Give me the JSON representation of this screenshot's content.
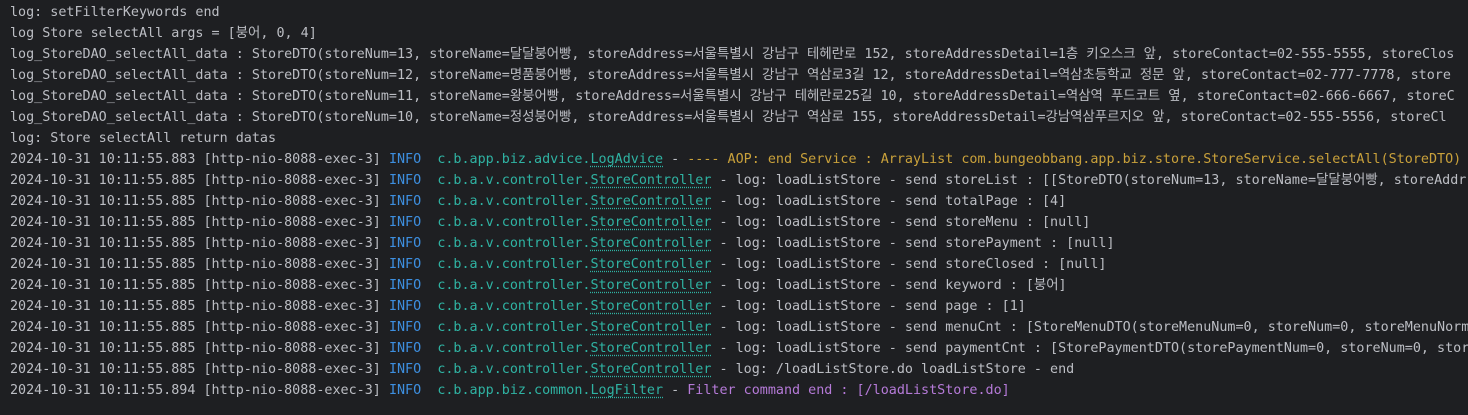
{
  "colors": {
    "background": "#1e1f22",
    "text": "#bcbec4",
    "info_level": "#3d8fe0",
    "logger": "#2fb3a3",
    "aop_message": "#c9a13b",
    "filter_message": "#b57ad8"
  },
  "plain_lines": [
    "log: setFilterKeywords end",
    "log Store selectAll args = [붕어, 0, 4]",
    "log_StoreDAO_selectAll_data : StoreDTO(storeNum=13, storeName=달달붕어빵, storeAddress=서울특별시 강남구 테헤란로 152, storeAddressDetail=1층 키오스크 앞, storeContact=02-555-5555, storeClos",
    "log_StoreDAO_selectAll_data : StoreDTO(storeNum=12, storeName=명품붕어빵, storeAddress=서울특별시 강남구 역삼로3길 12, storeAddressDetail=역삼초등학교 정문 앞, storeContact=02-777-7778, store",
    "log_StoreDAO_selectAll_data : StoreDTO(storeNum=11, storeName=왕붕어빵, storeAddress=서울특별시 강남구 테헤란로25길 10, storeAddressDetail=역삼역 푸드코트 옆, storeContact=02-666-6667, storeC",
    "log_StoreDAO_selectAll_data : StoreDTO(storeNum=10, storeName=정성붕어빵, storeAddress=서울특별시 강남구 역삼로 155, storeAddressDetail=강남역삼푸르지오 앞, storeContact=02-555-5556, storeCl",
    "log: Store selectAll return datas"
  ],
  "log_entries": [
    {
      "timestamp": "2024-10-31 10:11:55.883",
      "thread": "[http-nio-8088-exec-3]",
      "level": "INFO",
      "logger_pkg": "c.b.app.biz.advice.",
      "logger_class": "LogAdvice",
      "separator": "-",
      "message": "---- AOP: end Service : ArrayList com.bungeobbang.app.biz.store.StoreService.selectAll(StoreDTO)"
    },
    {
      "timestamp": "2024-10-31 10:11:55.885",
      "thread": "[http-nio-8088-exec-3]",
      "level": "INFO",
      "logger_pkg": "c.b.a.v.controller.",
      "logger_class": "StoreController",
      "separator": "-",
      "message": "log: loadListStore - send storeList : [[StoreDTO(storeNum=13, storeName=달달붕어빵, storeAddr"
    },
    {
      "timestamp": "2024-10-31 10:11:55.885",
      "thread": "[http-nio-8088-exec-3]",
      "level": "INFO",
      "logger_pkg": "c.b.a.v.controller.",
      "logger_class": "StoreController",
      "separator": "-",
      "message": "log: loadListStore - send totalPage : [4]"
    },
    {
      "timestamp": "2024-10-31 10:11:55.885",
      "thread": "[http-nio-8088-exec-3]",
      "level": "INFO",
      "logger_pkg": "c.b.a.v.controller.",
      "logger_class": "StoreController",
      "separator": "-",
      "message": "log: loadListStore - send storeMenu : [null]"
    },
    {
      "timestamp": "2024-10-31 10:11:55.885",
      "thread": "[http-nio-8088-exec-3]",
      "level": "INFO",
      "logger_pkg": "c.b.a.v.controller.",
      "logger_class": "StoreController",
      "separator": "-",
      "message": "log: loadListStore - send storePayment : [null]"
    },
    {
      "timestamp": "2024-10-31 10:11:55.885",
      "thread": "[http-nio-8088-exec-3]",
      "level": "INFO",
      "logger_pkg": "c.b.a.v.controller.",
      "logger_class": "StoreController",
      "separator": "-",
      "message": "log: loadListStore - send storeClosed : [null]"
    },
    {
      "timestamp": "2024-10-31 10:11:55.885",
      "thread": "[http-nio-8088-exec-3]",
      "level": "INFO",
      "logger_pkg": "c.b.a.v.controller.",
      "logger_class": "StoreController",
      "separator": "-",
      "message": "log: loadListStore - send keyword : [붕어]"
    },
    {
      "timestamp": "2024-10-31 10:11:55.885",
      "thread": "[http-nio-8088-exec-3]",
      "level": "INFO",
      "logger_pkg": "c.b.a.v.controller.",
      "logger_class": "StoreController",
      "separator": "-",
      "message": "log: loadListStore - send page : [1]"
    },
    {
      "timestamp": "2024-10-31 10:11:55.885",
      "thread": "[http-nio-8088-exec-3]",
      "level": "INFO",
      "logger_pkg": "c.b.a.v.controller.",
      "logger_class": "StoreController",
      "separator": "-",
      "message": "log: loadListStore - send menuCnt : [StoreMenuDTO(storeMenuNum=0, storeNum=0, storeMenuNorma"
    },
    {
      "timestamp": "2024-10-31 10:11:55.885",
      "thread": "[http-nio-8088-exec-3]",
      "level": "INFO",
      "logger_pkg": "c.b.a.v.controller.",
      "logger_class": "StoreController",
      "separator": "-",
      "message": "log: loadListStore - send paymentCnt : [StorePaymentDTO(storePaymentNum=0, storeNum=0, store"
    },
    {
      "timestamp": "2024-10-31 10:11:55.885",
      "thread": "[http-nio-8088-exec-3]",
      "level": "INFO",
      "logger_pkg": "c.b.a.v.controller.",
      "logger_class": "StoreController",
      "separator": "-",
      "message": "log: /loadListStore.do loadListStore - end"
    },
    {
      "timestamp": "2024-10-31 10:11:55.894",
      "thread": "[http-nio-8088-exec-3]",
      "level": "INFO",
      "logger_pkg": "c.b.app.biz.common.",
      "logger_class": "LogFilter",
      "separator": "-",
      "message": "Filter command end : [/loadListStore.do]"
    }
  ]
}
